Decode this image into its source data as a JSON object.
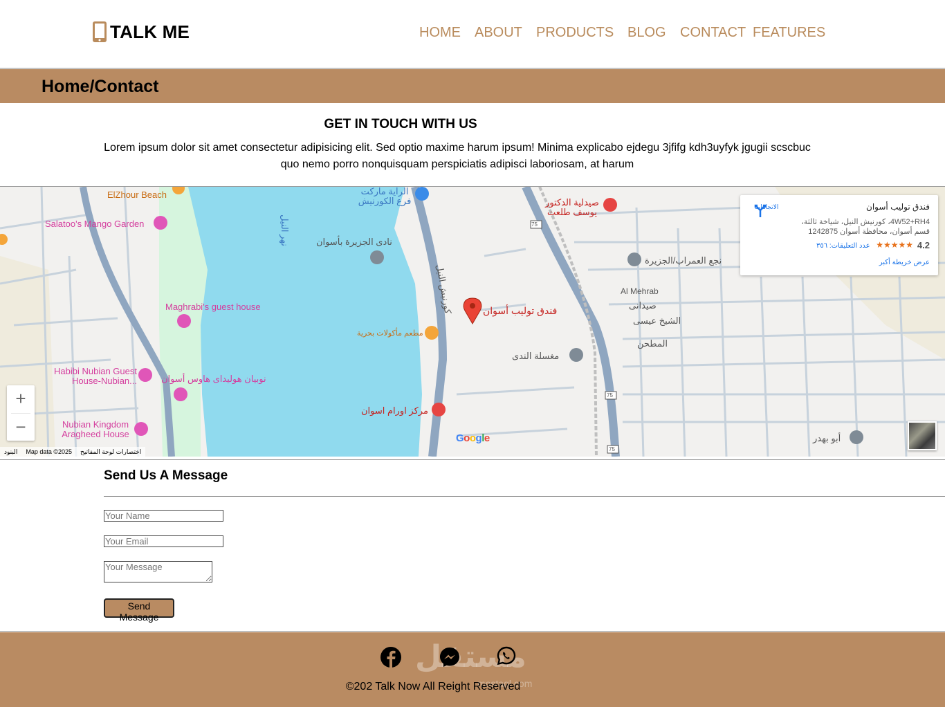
{
  "header": {
    "logo_text": "TALK ME",
    "nav": [
      "HOME",
      "ABOUT",
      "PRODUCTS",
      "BLOG",
      "CONTACT",
      "FEATURES"
    ]
  },
  "breadcrumb": "Home/Contact",
  "intro": {
    "title": "GET IN TOUCH WITH US",
    "text": "Lorem ipsum dolor sit amet consectetur adipisicing elit. Sed optio maxime harum ipsum! Minima explicabo ejdegu 3jfifg kdh3uyfyk jgugii scscbuc quo nemo porro nonquisquam perspiciatis adipisci laboriosam, at harum"
  },
  "map": {
    "labels": {
      "elzhour": "ElZhour Beach",
      "salatoo": "Salatoo's Mango Garden",
      "maghrabi": "Maghrabi's guest house",
      "habibi": "Habibi Nubian Guest House-Nubian...",
      "nubian_holiday": "نوبيان هوليداى هاوس أسوان",
      "nubian_kingdom": "Nubian Kingdom Aragheed House",
      "raya": "الراية ماركت فرع الكورنيش",
      "nile": "نهر النيل",
      "club": "نادى الجزيرة بأسوان",
      "corniche": "كورنيش النيل",
      "seafood": "مطعم مأكولات بحرية",
      "tumor": "مركز اورام اسوان",
      "pharmacy": "صيدلية الدكتور يوسف طلعت",
      "hotel": "فندق توليب أسوان",
      "naga": "نجع العمراب/الجزيرة",
      "mehrab": "Al Mehrab",
      "saydani": "صيدانى",
      "sheikh": "الشيخ عيسى",
      "mathan": "المطحن",
      "laundry": "مغسلة الندى",
      "abu": "أبو بهدر",
      "route": "75"
    },
    "info": {
      "name": "فندق توليب أسوان",
      "address": "4W52+RH4، كورنيش النيل، شياخة ثالثة، قسم أسوان، محافظة أسوان 1242875",
      "rating": "4.2",
      "stars": "★★★★★",
      "reviews": "عدد التعليقات: ٣٥٦",
      "more": "عرض خريطة أكبر",
      "directions": "الاتجاهات"
    },
    "google": "Google",
    "footer": [
      "البنود",
      "Map data ©2025",
      "اختصارات لوحة المفاتيح"
    ],
    "zoom_in": "+",
    "zoom_out": "−"
  },
  "message": {
    "title": "Send Us A Message",
    "name_placeholder": "Your Name",
    "email_placeholder": "Your Email",
    "message_placeholder": "Your Message",
    "send_label": "Send Message"
  },
  "footer": {
    "copyright": "©202 Talk Now All Reight Reserved",
    "watermark": "مستقل",
    "watermark_sub": "mostaql.com"
  },
  "colors": {
    "accent": "#b98b62",
    "nav_text": "#b98b5c"
  }
}
